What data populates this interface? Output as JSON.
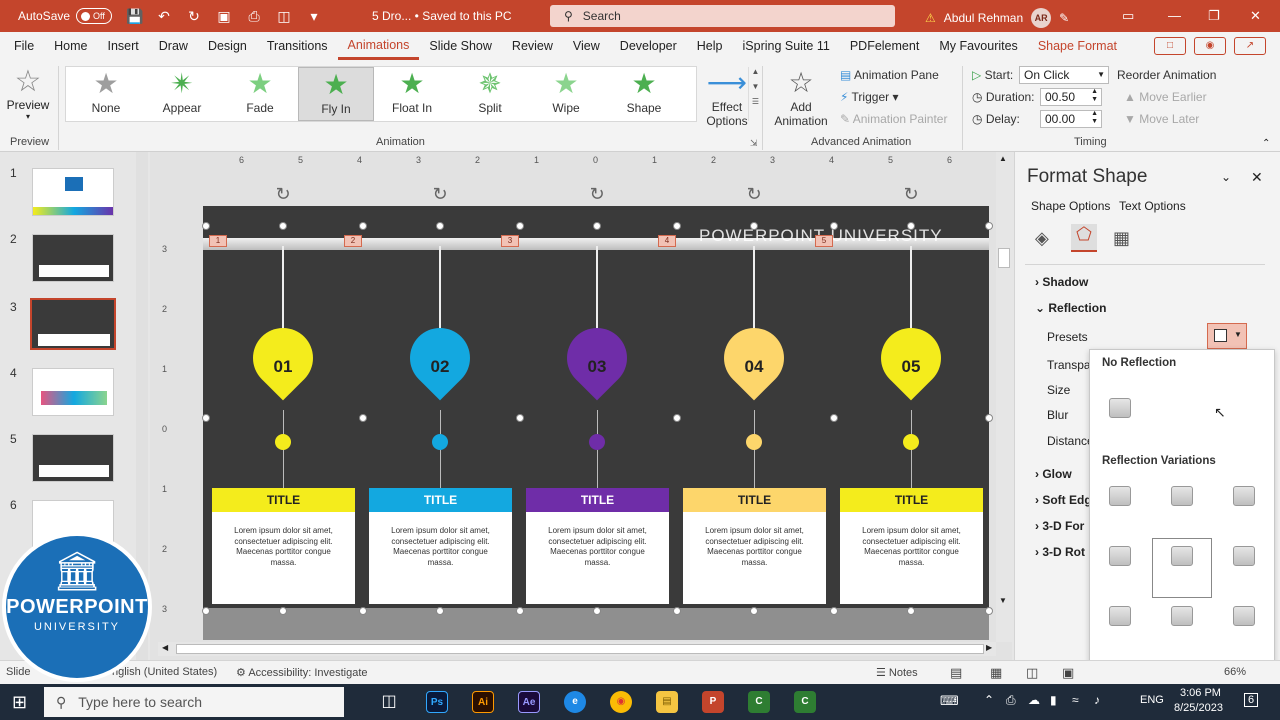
{
  "titlebar": {
    "autosave_label": "AutoSave",
    "autosave_state": "Off",
    "doc_title": "5 Dro... • Saved to this PC",
    "search_placeholder": "Search",
    "user_name": "Abdul Rehman",
    "user_initials": "AR"
  },
  "tabs": [
    "File",
    "Home",
    "Insert",
    "Draw",
    "Design",
    "Transitions",
    "Animations",
    "Slide Show",
    "Review",
    "View",
    "Developer",
    "Help",
    "iSpring Suite 11",
    "PDFelement",
    "My Favourites",
    "Shape Format"
  ],
  "active_tab": "Animations",
  "ribbon": {
    "preview_label": "Preview",
    "preview_group": "Preview",
    "animations": [
      "None",
      "Appear",
      "Fade",
      "Fly In",
      "Float In",
      "Split",
      "Wipe",
      "Shape"
    ],
    "selected_animation": "Fly In",
    "animation_group": "Animation",
    "effect_options": "Effect Options",
    "add_animation": "Add Animation",
    "animation_pane": "Animation Pane",
    "trigger": "Trigger",
    "animation_painter": "Animation Painter",
    "advanced_group": "Advanced Animation",
    "start_label": "Start:",
    "start_value": "On Click",
    "duration_label": "Duration:",
    "duration_value": "00.50",
    "delay_label": "Delay:",
    "delay_value": "00.00",
    "reorder": "Reorder Animation",
    "move_earlier": "Move Earlier",
    "move_later": "Move Later",
    "timing_group": "Timing",
    "colors": {
      "accent": "#c4452c",
      "star_green": "#4caf50",
      "star_gray": "#9e9e9e"
    }
  },
  "slides": {
    "numbers": [
      "1",
      "2",
      "3",
      "4",
      "5",
      "6"
    ],
    "selected": "3"
  },
  "rulers": {
    "h_ticks": [
      "6",
      "5",
      "4",
      "3",
      "2",
      "1",
      "0",
      "1",
      "2",
      "3",
      "4",
      "5",
      "6"
    ],
    "v_ticks": [
      "3",
      "2",
      "1",
      "0",
      "1",
      "2",
      "3"
    ]
  },
  "slide": {
    "watermark": "POWERPOINT UNIVERSITY",
    "badges": [
      "1",
      "2",
      "3",
      "4",
      "5"
    ],
    "columns": [
      {
        "num": "01",
        "title": "TITLE",
        "body": "Lorem ipsum dolor sit amet, consectetuer adipiscing elit. Maecenas porttitor congue massa.",
        "color": "#f4ec1c"
      },
      {
        "num": "02",
        "title": "TITLE",
        "body": "Lorem ipsum dolor sit amet, consectetuer adipiscing elit. Maecenas porttitor congue massa.",
        "color": "#13a8e0"
      },
      {
        "num": "03",
        "title": "TITLE",
        "body": "Lorem ipsum dolor sit amet, consectetuer adipiscing elit. Maecenas porttitor congue massa.",
        "color": "#6f2da8"
      },
      {
        "num": "04",
        "title": "TITLE",
        "body": "Lorem ipsum dolor sit amet, consectetuer adipiscing elit. Maecenas porttitor congue massa.",
        "color": "#fdd66b"
      },
      {
        "num": "05",
        "title": "TITLE",
        "body": "Lorem ipsum dolor sit amet, consectetuer adipiscing elit. Maecenas porttitor congue massa.",
        "color": "#f4ec1c"
      }
    ]
  },
  "pane": {
    "title": "Format Shape",
    "shape_options": "Shape Options",
    "text_options": "Text Options",
    "shadow": "Shadow",
    "reflection": "Reflection",
    "presets": "Presets",
    "transparency": "Transpar",
    "size": "Size",
    "blur": "Blur",
    "distance": "Distance",
    "glow": "Glow",
    "soft_edges": "Soft Edg",
    "three_d_format": "3-D For",
    "three_d_rotation": "3-D Rot"
  },
  "reflection_menu": {
    "no_reflection": "No Reflection",
    "variations": "Reflection Variations"
  },
  "status": {
    "slide": "Slide",
    "language": "nglish (United States)",
    "accessibility": "Accessibility: Investigate",
    "notes": "Notes",
    "zoom": "66%"
  },
  "taskbar": {
    "search_placeholder": "Type here to search",
    "lang": "ENG",
    "time": "3:06 PM",
    "date": "8/25/2023",
    "notif_count": "6"
  },
  "logo": {
    "line1": "POWERPOINT",
    "line2": "UNIVERSITY"
  }
}
